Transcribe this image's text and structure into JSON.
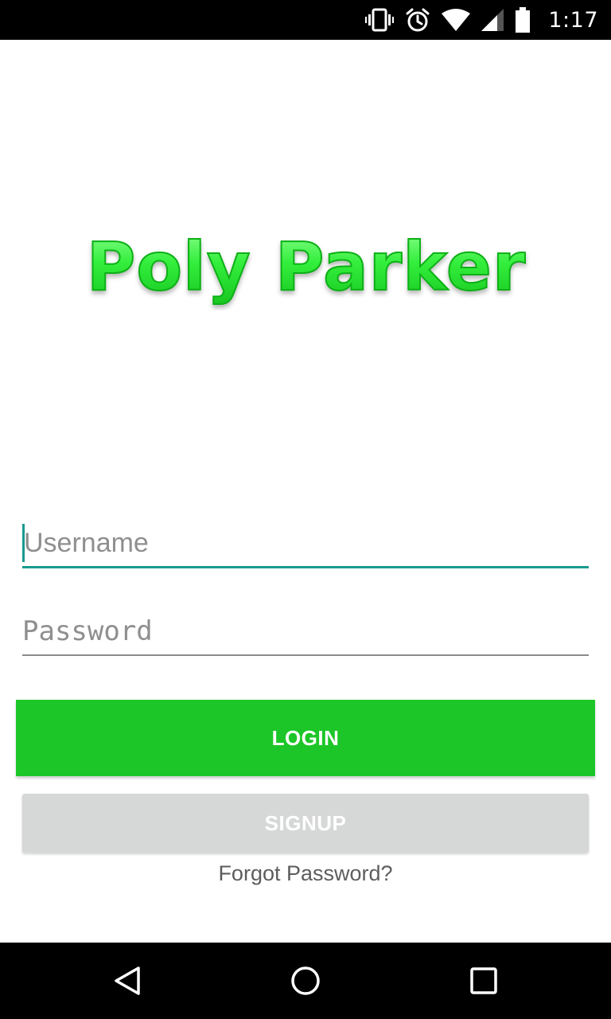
{
  "status_bar": {
    "time": "1:17",
    "icons": [
      "vibrate-icon",
      "alarm-icon",
      "wifi-icon",
      "signal-icon",
      "battery-icon"
    ]
  },
  "logo": {
    "text": "Poly Parker",
    "color": "#2ee83a"
  },
  "form": {
    "username_placeholder": "Username",
    "username_value": "",
    "password_placeholder": "Password",
    "password_value": ""
  },
  "buttons": {
    "login_label": "LOGIN",
    "signup_label": "SIGNUP",
    "forgot_label": "Forgot Password?"
  },
  "colors": {
    "accent": "#1a9a8f",
    "login_bg": "#1cc628",
    "signup_bg": "#d6d7d7"
  },
  "nav_bar": {
    "icons": [
      "back-icon",
      "home-icon",
      "recents-icon"
    ]
  }
}
